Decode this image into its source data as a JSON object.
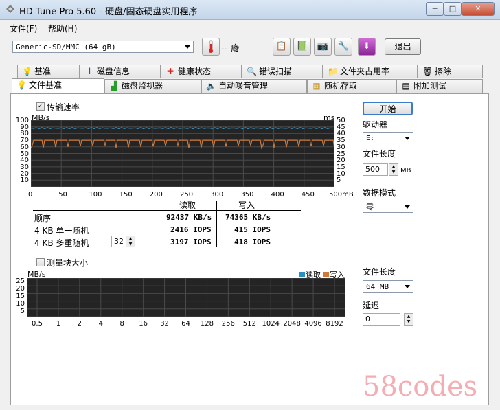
{
  "window": {
    "title": "HD Tune Pro 5.60 - 硬盘/固态硬盘实用程序",
    "min": "─",
    "max": "□",
    "close": "✕"
  },
  "menu": {
    "file": "文件(F)",
    "help": "帮助(H)"
  },
  "toolbar": {
    "drive": "Generic-SD/MMC  (64 gB)",
    "temp": "-- 癈",
    "exit": "退出"
  },
  "tabs_row1": [
    {
      "label": "基准",
      "icon": "bulb-icon"
    },
    {
      "label": "磁盘信息",
      "icon": "info-icon"
    },
    {
      "label": "健康状态",
      "icon": "health-cross-icon"
    },
    {
      "label": "错误扫描",
      "icon": "magnifier-icon"
    },
    {
      "label": "文件夹占用率",
      "icon": "folder-icon"
    },
    {
      "label": "擦除",
      "icon": "trash-icon"
    }
  ],
  "tabs_row2": [
    {
      "label": "文件基准",
      "icon": "bulb-file-icon"
    },
    {
      "label": "磁盘监视器",
      "icon": "monitor-chart-icon"
    },
    {
      "label": "自动噪音管理",
      "icon": "speaker-icon"
    },
    {
      "label": "随机存取",
      "icon": "random-access-icon"
    },
    {
      "label": "附加测试",
      "icon": "extra-tests-icon"
    }
  ],
  "transfer": {
    "checkbox_label": "传输速率",
    "unit_left": "MB/s",
    "unit_right": "ms",
    "y_left_ticks": [
      "100",
      "90",
      "80",
      "70",
      "60",
      "50",
      "40",
      "30",
      "20",
      "10"
    ],
    "y_right_ticks": [
      "50",
      "45",
      "40",
      "35",
      "30",
      "25",
      "20",
      "15",
      "10",
      "5"
    ],
    "x_ticks": [
      "0",
      "50",
      "100",
      "150",
      "200",
      "250",
      "300",
      "350",
      "400",
      "450",
      "500mB"
    ]
  },
  "chart_data": {
    "type": "line",
    "title": "",
    "xlabel": "",
    "ylabel": "MB/s",
    "xlim": [
      0,
      500
    ],
    "ylim": [
      0,
      100
    ],
    "series": [
      {
        "name": "读取",
        "color": "#3aa0d0",
        "approx_level": 88
      },
      {
        "name": "写入",
        "color": "#d07a3a",
        "approx_level": 70,
        "dip_level": 58,
        "dip_every": 20
      }
    ],
    "grid": true
  },
  "results": {
    "header_read": "读取",
    "header_write": "写入",
    "rows": [
      {
        "label": "顺序",
        "read": "92437 KB/s",
        "write": "74365 KB/s"
      },
      {
        "label": "4 KB 单一随机",
        "read": "2416 IOPS",
        "write": "415 IOPS"
      },
      {
        "label": "4 KB 多重随机",
        "read": "3197 IOPS",
        "write": "418 IOPS",
        "queue": "32"
      }
    ]
  },
  "right": {
    "start": "开始",
    "drive_label": "驱动器",
    "drive_value": "E:",
    "file_len_label": "文件长度",
    "file_len_value": "500",
    "file_len_unit": "MB",
    "data_mode_label": "数据模式",
    "data_mode_value": "零"
  },
  "block": {
    "checkbox_label": "测量块大小",
    "unit": "MB/s",
    "legend_read": "读取",
    "legend_write": "写入",
    "legend_read_color": "#2b8fc0",
    "legend_write_color": "#d07a3a",
    "y_ticks": [
      "25",
      "20",
      "15",
      "10",
      "5"
    ],
    "x_ticks": [
      "0.5",
      "1",
      "2",
      "4",
      "8",
      "16",
      "32",
      "64",
      "128",
      "256",
      "512",
      "1024",
      "2048",
      "4096",
      "8192"
    ],
    "file_len_label": "文件长度",
    "file_len_value": "64 MB",
    "delay_label": "延迟",
    "delay_value": "0"
  },
  "watermark": "58codes"
}
